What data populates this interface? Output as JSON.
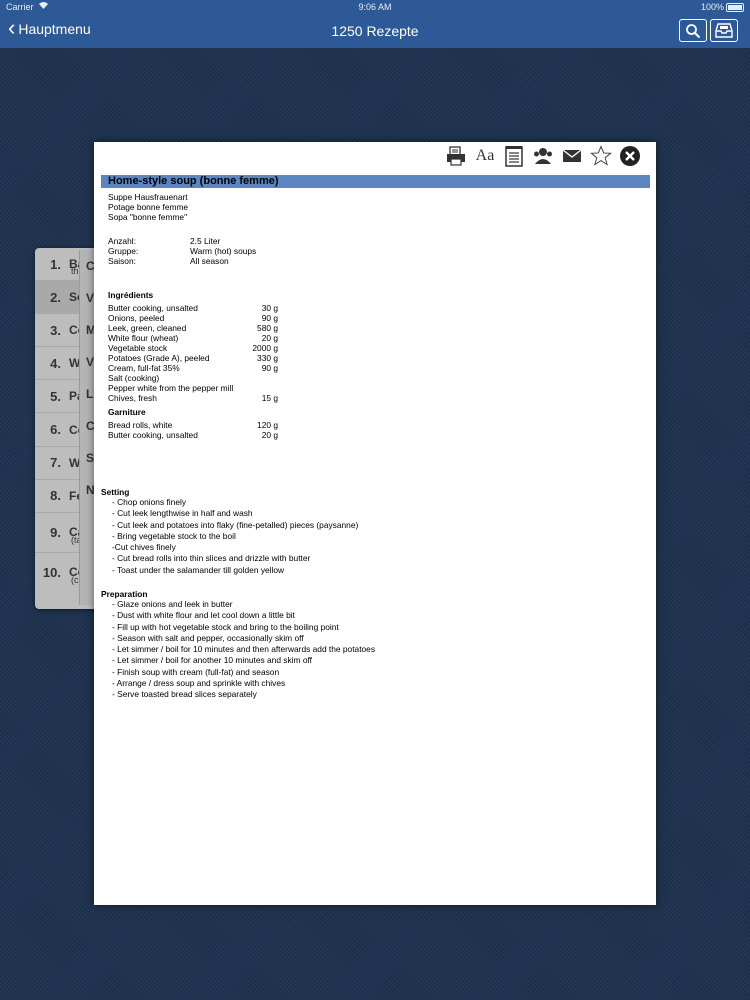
{
  "status_bar": {
    "carrier": "Carrier",
    "time": "9:06 AM",
    "battery": "100%"
  },
  "nav": {
    "back_label": "Hauptmenu",
    "title": "1250 Rezepte"
  },
  "list": [
    {
      "num": "1.",
      "text": "Ba",
      "sub": "th"
    },
    {
      "num": "2.",
      "text": "So",
      "sub": ""
    },
    {
      "num": "3.",
      "text": "Co",
      "sub": ""
    },
    {
      "num": "4.",
      "text": "W",
      "sub": ""
    },
    {
      "num": "5.",
      "text": "Pa",
      "sub": ""
    },
    {
      "num": "6.",
      "text": "Co",
      "sub": ""
    },
    {
      "num": "7.",
      "text": "W",
      "sub": ""
    },
    {
      "num": "8.",
      "text": "Fe",
      "sub": ""
    },
    {
      "num": "9.",
      "text": "Ca",
      "sub": "(ta"
    },
    {
      "num": "10.",
      "text": "Co",
      "sub": "(c"
    }
  ],
  "back_list": [
    "C",
    "V",
    "M",
    "V",
    "L",
    "C",
    "S",
    "N",
    "",
    ""
  ],
  "recipe": {
    "title": "Home-style soup (bonne femme)",
    "aliases": [
      "Suppe Hausfrauenart",
      "Potage bonne femme",
      "Sopa \"bonne femme\""
    ],
    "meta": [
      {
        "key": "Anzahl:",
        "value": " 2.5 Liter"
      },
      {
        "key": "Gruppe:",
        "value": "Warm (hot) soups"
      },
      {
        "key": "Saison:",
        "value": "All season"
      }
    ],
    "ingredients_heading": "Ingrédients",
    "ingredients": [
      {
        "name": "Butter cooking, unsalted",
        "qty": "30 g"
      },
      {
        "name": "Onions, peeled",
        "qty": "90 g"
      },
      {
        "name": "Leek, green, cleaned",
        "qty": "580 g"
      },
      {
        "name": "White flour (wheat)",
        "qty": "20 g"
      },
      {
        "name": "Vegetable stock",
        "qty": "2000 g"
      },
      {
        "name": "Potatoes (Grade A), peeled",
        "qty": "330 g"
      },
      {
        "name": "Cream, full-fat 35%",
        "qty": "90 g"
      },
      {
        "name": "Salt (cooking)",
        "qty": ""
      },
      {
        "name": "Pepper white from the pepper mill",
        "qty": ""
      },
      {
        "name": "Chives, fresh",
        "qty": "15 g"
      }
    ],
    "garniture_heading": "Garniture",
    "garniture": [
      {
        "name": "Bread rolls, white",
        "qty": "120 g"
      },
      {
        "name": "Butter cooking, unsalted",
        "qty": "20 g"
      }
    ],
    "setting_heading": "Setting",
    "setting": [
      "- Chop onions finely",
      "- Cut leek lengthwise in half and wash",
      "- Cut leek and potatoes into flaky (fine-petalled) pieces (paysanne)",
      "- Bring vegetable stock to the boil",
      "-Cut chives finely",
      "- Cut bread rolls into thin slices and drizzle with butter",
      "- Toast under the salamander till golden yellow"
    ],
    "preparation_heading": "Preparation",
    "preparation": [
      "- Glaze onions and leek in butter",
      "- Dust with white flour and let cool down a little bit",
      "- Fill up with hot vegetable stock and bring to the boiling point",
      "- Season with salt and pepper, occasionally skim off",
      "- Let simmer / boil for 10 minutes and then afterwards add the potatoes",
      "- Let simmer / boil for another 10 minutes and skim off",
      "- Finish soup with cream (full-fat) and season",
      "- Arrange / dress soup and sprinkle with chives",
      "- Serve toasted bread slices separately"
    ]
  }
}
